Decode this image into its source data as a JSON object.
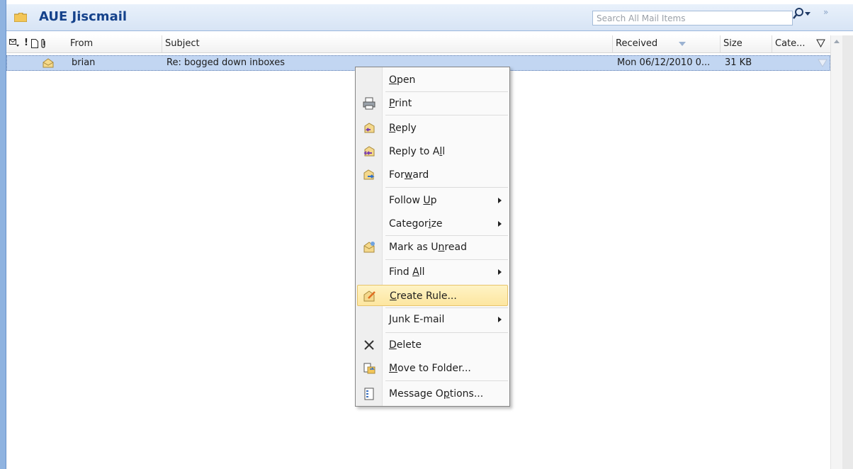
{
  "header": {
    "folder_title": "AUE Jiscmail",
    "search_placeholder": "Search All Mail Items",
    "expand_glyph": "»"
  },
  "columns": {
    "from": "From",
    "subject": "Subject",
    "received": "Received",
    "size": "Size",
    "categories": "Cate..."
  },
  "message": {
    "from": "brian",
    "subject": "Re: bogged down inboxes",
    "received": "Mon 06/12/2010 0...",
    "size": "31 KB",
    "icon": "envelope-open-icon"
  },
  "context_menu": {
    "items": [
      {
        "label": "Open",
        "accel": "O"
      },
      {
        "label": "Print",
        "accel": "P",
        "icon": "printer-icon"
      },
      {
        "label": "Reply",
        "accel": "R",
        "icon": "reply-icon"
      },
      {
        "label": "Reply to All",
        "accel": "l",
        "icon": "reply-all-icon"
      },
      {
        "label": "Forward",
        "accel": "w",
        "icon": "forward-icon"
      },
      {
        "label": "Follow Up",
        "accel": "U",
        "submenu": true
      },
      {
        "label": "Categorize",
        "accel": "i",
        "submenu": true
      },
      {
        "label": "Mark as Unread",
        "accel": "n",
        "icon": "mark-unread-icon"
      },
      {
        "label": "Find All",
        "accel": "A",
        "submenu": true
      },
      {
        "label": "Create Rule...",
        "accel": "C",
        "icon": "create-rule-icon",
        "highlighted": true
      },
      {
        "label": "Junk E-mail",
        "accel": "J",
        "submenu": true
      },
      {
        "label": "Delete",
        "accel": "D",
        "icon": "delete-icon"
      },
      {
        "label": "Move to Folder...",
        "accel": "M",
        "icon": "move-folder-icon"
      },
      {
        "label": "Message Options...",
        "accel": "p",
        "icon": "message-options-icon"
      }
    ]
  },
  "colors": {
    "title": "#15428b",
    "selected_row": "#c2d6f2",
    "highlight": "#fde6a0"
  }
}
